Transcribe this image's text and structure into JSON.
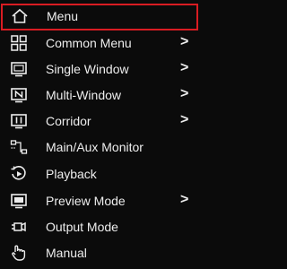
{
  "menu": {
    "items": [
      {
        "label": "Menu",
        "icon": "home-icon",
        "has_submenu": false,
        "selected": true
      },
      {
        "label": "Common Menu",
        "icon": "grid-icon",
        "has_submenu": true
      },
      {
        "label": "Single Window",
        "icon": "single-window-icon",
        "has_submenu": true
      },
      {
        "label": "Multi-Window",
        "icon": "multi-window-icon",
        "has_submenu": true
      },
      {
        "label": "Corridor",
        "icon": "corridor-icon",
        "has_submenu": true
      },
      {
        "label": "Main/Aux Monitor",
        "icon": "monitor-switch-icon",
        "has_submenu": false
      },
      {
        "label": "Playback",
        "icon": "playback-icon",
        "has_submenu": false
      },
      {
        "label": "Preview Mode",
        "icon": "preview-mode-icon",
        "has_submenu": true
      },
      {
        "label": "Output Mode",
        "icon": "output-mode-icon",
        "has_submenu": false
      },
      {
        "label": "Manual",
        "icon": "manual-icon",
        "has_submenu": false
      }
    ],
    "chevron": ">",
    "colors": {
      "background": "#0b0b0b",
      "text": "#ededed",
      "selection_border": "#d91c22"
    }
  }
}
